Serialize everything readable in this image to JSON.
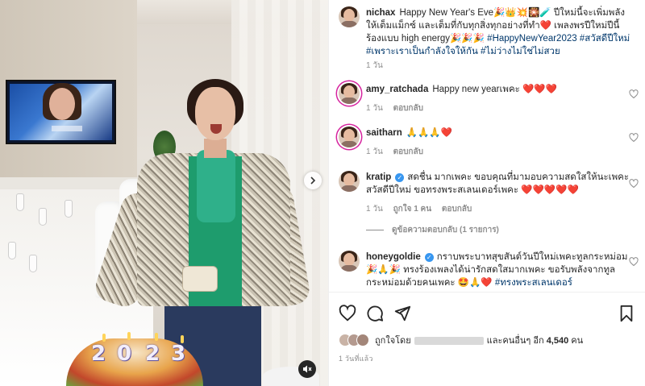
{
  "post": {
    "caption": {
      "username": "nichax",
      "text_1": "Happy New Year's Eve🎉👑💥🎇🧪 ปีใหม่นี้จะเพิ่มพลังให้เต็มแม็กซ์ และเต็มที่กับทุกสิ่งทุกอย่างที่ทำ❤️ เพลงพรปีใหม่ปีนี้ร้องแบบ high energy🎉🎉🎉",
      "hashtags": "#HappyNewYear2023 #สวัสดีปีใหม่ #เพราะเราเป็นกำลังใจให้กัน #ไม่ว่างไม่ใช่ไม่สวย",
      "time": "1 วัน"
    },
    "comments": [
      {
        "username": "amy_ratchada",
        "text": "Happy new yearเพคะ ❤️❤️❤️",
        "time": "1 วัน",
        "reply": "ตอบกลับ"
      },
      {
        "username": "saitharn",
        "text": "🙏🙏🙏❤️",
        "time": "1 วัน",
        "reply": "ตอบกลับ"
      },
      {
        "username": "kratip",
        "text": "สดชื่น มากเพคะ ขอบคุณที่มามอบความสดใสให้นะเพคะ สวัสดีปีใหม่ ขอทรงพระสเลนเดอร์เพคะ ❤️❤️❤️❤️❤️",
        "time": "1 วัน",
        "likes": "ถูกใจ 1 คน",
        "reply": "ตอบกลับ"
      },
      {
        "username": "honeygoldie",
        "text": "กราบพระบาทสุขสันต์วันปีใหม่เพคะทูลกระหม่อม 🎉🙏🎉 ทรงร้องเพลงได้น่ารักสดใสมากเพคะ ขอรับพลังจากทูลกระหม่อมด้วยคนเพคะ 🤩🙏❤️",
        "hashtag": "#ทรงพระสเลนเดอร์"
      }
    ],
    "view_replies": "ดูข้อความตอบกลับ (1 รายการ)",
    "likes": {
      "prefix": "ถูกใจโดย",
      "suffix_pre": "และคนอื่นๆ อีก",
      "count": "4,540",
      "suffix_post": "คน"
    },
    "posted_time": "1 วันที่แล้ว"
  },
  "media": {
    "cake_numbers": [
      "2",
      "0",
      "2",
      "3"
    ]
  },
  "colors": {
    "verified": "#3897f0",
    "heart": "#ed4956",
    "link": "#00376b",
    "meta": "#8e8e8e"
  },
  "icons": {
    "like": "heart-icon",
    "comment": "comment-icon",
    "share": "paper-plane-icon",
    "save": "bookmark-icon",
    "next": "chevron-right-icon",
    "mute": "speaker-muted-icon"
  }
}
